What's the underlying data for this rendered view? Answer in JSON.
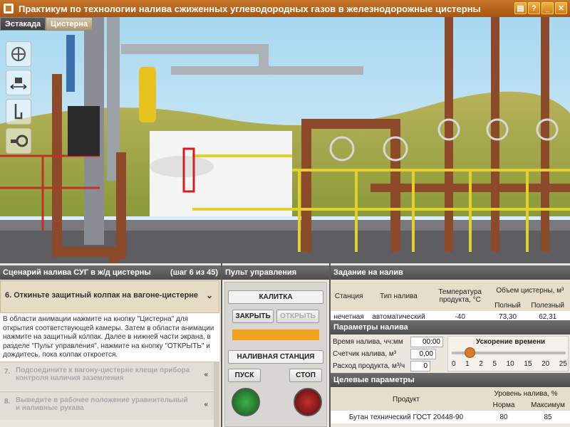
{
  "app": {
    "title": "Практикум по технологии налива сжиженных углеводородных газов в железнодорожные цистерны"
  },
  "window_buttons": [
    {
      "icon": "document-icon",
      "label": "▤"
    },
    {
      "icon": "help-icon",
      "label": "?"
    },
    {
      "icon": "minimize-icon",
      "label": "_"
    },
    {
      "icon": "close-icon",
      "label": "✕"
    }
  ],
  "tabs": [
    {
      "label": "Эстакада",
      "active": true
    },
    {
      "label": "Цистерна",
      "active": false
    }
  ],
  "tools": [
    {
      "icon": "valve-wheel-icon"
    },
    {
      "icon": "move-camera-icon"
    },
    {
      "icon": "clamp-icon"
    },
    {
      "icon": "hose-icon"
    }
  ],
  "scenario": {
    "title": "Сценарий налива СУГ в ж/д цистерны",
    "progress": "(шаг 6 из 45)",
    "active_step": "6.  Откиньте защитный колпак на вагоне-цистерне",
    "description": "В области анимации нажмите на кнопку \"Цистерна\" для открытия соответствующей камеры. Затем в области анимации нажмите на защитный колпак. Далее в нижней части экрана, в разделе \"Пульт управления\", нажмите на кнопку \"ОТКРЫТЬ\" и дождитесь, пока колпак откроется.",
    "next_steps": [
      {
        "num": "7.",
        "text": "Подсоедините к вагону-цистерне клещи прибора контроля наличия заземления"
      },
      {
        "num": "8.",
        "text": "Выведите в рабочее положение уравнительный и наливные рукава"
      }
    ]
  },
  "control": {
    "title": "Пульт управления",
    "gate_label": "КАЛИТКА",
    "close_label": "ЗАКРЫТЬ",
    "open_label": "ОТКРЫТЬ",
    "station_label": "НАЛИВНАЯ СТАНЦИЯ",
    "start_label": "ПУСК",
    "stop_label": "СТОП"
  },
  "task": {
    "title": "Задание на налив",
    "headers": {
      "station": "Станция",
      "fill_type": "Тип налива",
      "temperature": "Температура продукта, °С",
      "volume": "Объем цистерны, м³",
      "full": "Полный",
      "useful": "Полезный"
    },
    "row": {
      "station": "нечетная",
      "fill_type": "автоматический",
      "temperature": "-40",
      "full": "73,30",
      "useful": "62,31"
    }
  },
  "params": {
    "title": "Параметры налива",
    "time_label": "Время налива, чч:мм",
    "time_value": "00:00",
    "counter_label": "Счетчик налива, м³",
    "counter_value": "0,00",
    "flow_label": "Расход продукта, м³/ч",
    "flow_value": "0",
    "speed_title": "Ускорение времени",
    "speed_ticks": [
      "0",
      "1",
      "2",
      "5",
      "10",
      "15",
      "20",
      "25"
    ],
    "speed_value": "1"
  },
  "target": {
    "title": "Целевые параметры",
    "product_header": "Продукт",
    "level_header": "Уровень налива, %",
    "norm_header": "Норма",
    "max_header": "Максимум",
    "row": {
      "product": "Бутан технический ГОСТ 20448-90",
      "norm": "80",
      "max": "85"
    }
  },
  "colors": {
    "accent": "#c8762a",
    "header_dark": "#555555",
    "indicator": "#f2a020",
    "start_lamp": "#1f7a2a",
    "stop_lamp": "#8a1010"
  }
}
